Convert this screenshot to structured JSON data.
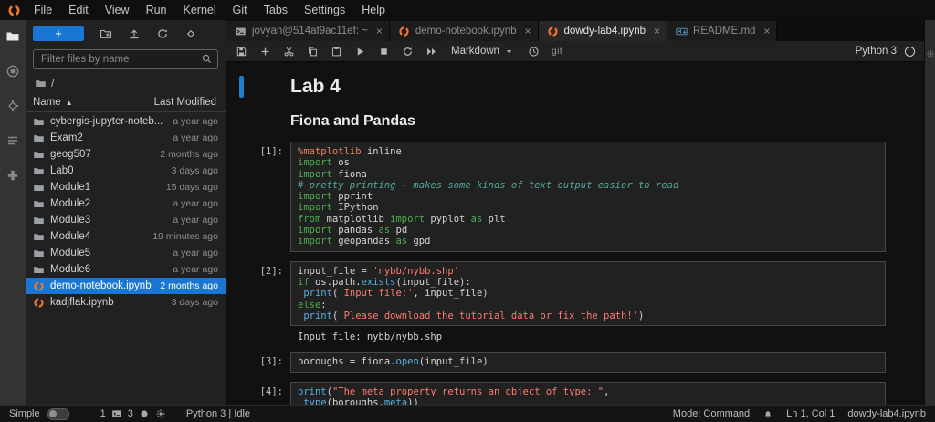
{
  "colors": {
    "accent": "#1976d2",
    "notebook_icon": "#f37726",
    "keyword": "#4caf50",
    "string": "#ff7b70",
    "comment": "#52a89e",
    "builtin": "#58aee0",
    "magic": "#e8855d"
  },
  "menubar": {
    "items": [
      "File",
      "Edit",
      "View",
      "Run",
      "Kernel",
      "Git",
      "Tabs",
      "Settings",
      "Help"
    ]
  },
  "activitybar": {
    "items": [
      {
        "icon": "files-icon",
        "active": true
      },
      {
        "icon": "running-icon",
        "active": false
      },
      {
        "icon": "git-icon",
        "active": false
      },
      {
        "icon": "toc-icon",
        "active": false
      },
      {
        "icon": "extensions-icon",
        "active": false
      }
    ]
  },
  "filebrowser": {
    "new_launcher_label": "+",
    "action_icons": [
      "new-folder-icon",
      "upload-icon",
      "refresh-icon",
      "git-clone-icon"
    ],
    "filter_placeholder": "Filter files by name",
    "breadcrumb_root": "/",
    "columns": {
      "name": "Name",
      "modified": "Last Modified"
    },
    "sort_indicator": "▲",
    "items": [
      {
        "name": "cybergis-jupyter-noteb...",
        "modified": "a year ago",
        "type": "folder",
        "selected": false
      },
      {
        "name": "Exam2",
        "modified": "a year ago",
        "type": "folder",
        "selected": false
      },
      {
        "name": "geog507",
        "modified": "2 months ago",
        "type": "folder",
        "selected": false
      },
      {
        "name": "Lab0",
        "modified": "3 days ago",
        "type": "folder",
        "selected": false
      },
      {
        "name": "Module1",
        "modified": "15 days ago",
        "type": "folder",
        "selected": false
      },
      {
        "name": "Module2",
        "modified": "a year ago",
        "type": "folder",
        "selected": false
      },
      {
        "name": "Module3",
        "modified": "a year ago",
        "type": "folder",
        "selected": false
      },
      {
        "name": "Module4",
        "modified": "19 minutes ago",
        "type": "folder",
        "selected": false
      },
      {
        "name": "Module5",
        "modified": "a year ago",
        "type": "folder",
        "selected": false
      },
      {
        "name": "Module6",
        "modified": "a year ago",
        "type": "folder",
        "selected": false
      },
      {
        "name": "demo-notebook.ipynb",
        "modified": "2 months ago",
        "type": "notebook",
        "selected": true
      },
      {
        "name": "kadjflak.ipynb",
        "modified": "3 days ago",
        "type": "notebook",
        "selected": false
      }
    ]
  },
  "tabs": [
    {
      "label": "jovyan@514af9ac11ef: ~",
      "icon": "terminal",
      "active": false
    },
    {
      "label": "demo-notebook.ipynb",
      "icon": "notebook",
      "active": false
    },
    {
      "label": "dowdy-lab4.ipynb",
      "icon": "notebook",
      "active": true
    },
    {
      "label": "README.md",
      "icon": "markdown",
      "active": false
    }
  ],
  "toolbar": {
    "icons": [
      "save-icon",
      "add-icon",
      "cut-icon",
      "copy-icon",
      "paste-icon",
      "run-icon",
      "stop-icon",
      "restart-icon",
      "run-all-icon"
    ],
    "cell_type": "Markdown",
    "git_label": "git",
    "kernel_name": "Python 3"
  },
  "notebook": {
    "cells": [
      {
        "kind": "markdown",
        "level": 1,
        "text": "Lab 4",
        "selected": true
      },
      {
        "kind": "markdown",
        "level": 2,
        "text": "Fiona and Pandas",
        "selected": false
      },
      {
        "kind": "code",
        "prompt": "[1]:",
        "lines": [
          [
            [
              "%matplotlib",
              "magic"
            ],
            [
              " inline",
              "pl"
            ]
          ],
          [
            [
              "import",
              "kw"
            ],
            [
              " os",
              "pl"
            ]
          ],
          [
            [
              "import",
              "kw"
            ],
            [
              " fiona",
              "pl"
            ]
          ],
          [
            [
              "# pretty printing - makes some kinds of text output easier to read",
              "com"
            ]
          ],
          [
            [
              "import",
              "kw"
            ],
            [
              " pprint",
              "pl"
            ]
          ],
          [
            [
              "import",
              "kw"
            ],
            [
              " IPython",
              "pl"
            ]
          ],
          [
            [
              "from",
              "kw"
            ],
            [
              " matplotlib ",
              "pl"
            ],
            [
              "import",
              "kw"
            ],
            [
              " pyplot ",
              "pl"
            ],
            [
              "as",
              "kw"
            ],
            [
              " plt",
              "pl"
            ]
          ],
          [
            [
              "import",
              "kw"
            ],
            [
              " pandas ",
              "pl"
            ],
            [
              "as",
              "kw"
            ],
            [
              " pd",
              "pl"
            ]
          ],
          [
            [
              "import",
              "kw"
            ],
            [
              " geopandas ",
              "pl"
            ],
            [
              "as",
              "kw"
            ],
            [
              " gpd",
              "pl"
            ]
          ]
        ]
      },
      {
        "kind": "code",
        "prompt": "[2]:",
        "lines": [
          [
            [
              "input_file ",
              "pl"
            ],
            [
              "=",
              "op"
            ],
            [
              " ",
              "pl"
            ],
            [
              "'nybb/nybb.shp'",
              "str"
            ]
          ],
          [
            [
              "if",
              "kw"
            ],
            [
              " os.path.",
              "pl"
            ],
            [
              "exists",
              "bi"
            ],
            [
              "(input_file):",
              "pl"
            ]
          ],
          [
            [
              " ",
              "pl"
            ],
            [
              "print",
              "bi"
            ],
            [
              "(",
              "pl"
            ],
            [
              "'Input file:'",
              "str"
            ],
            [
              ", input_file)",
              "pl"
            ]
          ],
          [
            [
              "else",
              "kw"
            ],
            [
              ":",
              "pl"
            ]
          ],
          [
            [
              " ",
              "pl"
            ],
            [
              "print",
              "bi"
            ],
            [
              "(",
              "pl"
            ],
            [
              "'Please download the tutorial data or fix the path!'",
              "str"
            ],
            [
              ")",
              "pl"
            ]
          ]
        ],
        "output": "Input file: nybb/nybb.shp"
      },
      {
        "kind": "code",
        "prompt": "[3]:",
        "lines": [
          [
            [
              "boroughs ",
              "pl"
            ],
            [
              "=",
              "op"
            ],
            [
              " fiona.",
              "pl"
            ],
            [
              "open",
              "bi"
            ],
            [
              "(input_file)",
              "pl"
            ]
          ]
        ]
      },
      {
        "kind": "code",
        "prompt": "[4]:",
        "lines": [
          [
            [
              "print",
              "bi"
            ],
            [
              "(",
              "pl"
            ],
            [
              "\"The meta property returns an object of type: \"",
              "str"
            ],
            [
              ",",
              "pl"
            ]
          ],
          [
            [
              " ",
              "pl"
            ],
            [
              "type",
              "bi"
            ],
            [
              "(boroughs.",
              "pl"
            ],
            [
              "meta",
              "bi"
            ],
            [
              "))",
              "pl"
            ]
          ]
        ]
      }
    ]
  },
  "statusbar": {
    "simple_label": "Simple",
    "terminal_count": "1",
    "kernel_count": "3",
    "kernel_status": "Python 3 | Idle",
    "mode_label": "Mode: Command",
    "cursor_position": "Ln 1, Col 1",
    "active_file": "dowdy-lab4.ipynb"
  }
}
